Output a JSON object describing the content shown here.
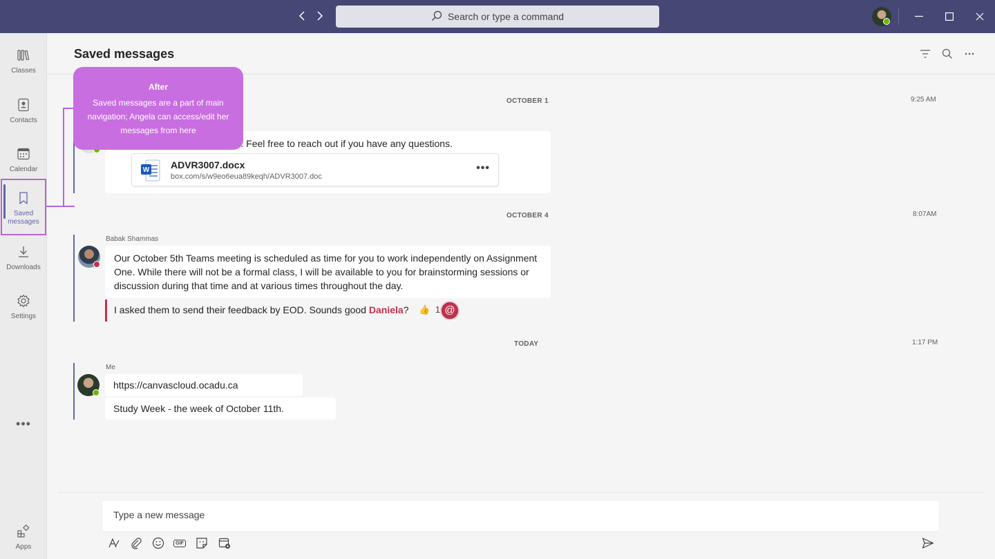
{
  "titlebar": {
    "search_placeholder": "Search or type a command"
  },
  "rail": {
    "items": [
      {
        "label": "Classes",
        "icon": "classes-icon"
      },
      {
        "label": "Contacts",
        "icon": "contacts-icon"
      },
      {
        "label": "Calendar",
        "icon": "calendar-icon"
      },
      {
        "label_line1": "Saved",
        "label_line2": "messages",
        "icon": "bookmark-icon",
        "active": true
      },
      {
        "label": "Downloads",
        "icon": "download-icon"
      },
      {
        "label": "Settings",
        "icon": "gear-icon"
      },
      {
        "label": "Apps",
        "icon": "apps-icon"
      }
    ],
    "more": "•••"
  },
  "header": {
    "title": "Saved messages"
  },
  "tooltip": {
    "title": "After",
    "body": "Saved messages are a part of main navigation; Angela can access/edit her messages from here"
  },
  "groups": [
    {
      "date": "OCTOBER 1",
      "time": "9:25 AM",
      "message_text": "abus. Feel free to reach out if you have any questions.",
      "file": {
        "name": "ADVR3007.docx",
        "url": "box.com/s/w9eo6eua89keqh/ADVR3007.doc",
        "more": "•••"
      }
    },
    {
      "date": "OCTOBER 4",
      "time": "8:07AM",
      "sender": "Babak Shammas",
      "message_text": "Our October 5th Teams meeting is scheduled as time for you to work independently on Assignment One. While there will not be a formal class, I will be available to you for brainstorming sessions or discussion during that time and at various times throughout the day.",
      "quote_prefix": "I asked them to send their feedback by EOD. Sounds good ",
      "quote_mention": "Daniela",
      "quote_suffix": "?",
      "reaction_emoji": "👍",
      "reaction_count": "1",
      "at_symbol": "@"
    },
    {
      "date": "TODAY",
      "time": "1:17 PM",
      "sender": "Me",
      "messages": [
        "https://canvascloud.ocadu.ca",
        "Study Week - the week of October 11th."
      ]
    }
  ],
  "compose": {
    "placeholder": "Type a new message",
    "gif_label": "GIF"
  },
  "colors": {
    "titlebar": "#464775",
    "accent": "#6264a7",
    "tooltip": "#c86ee0",
    "highlight_border": "#b865d4",
    "urgent": "#c4314b",
    "presence_available": "#6bb700"
  }
}
